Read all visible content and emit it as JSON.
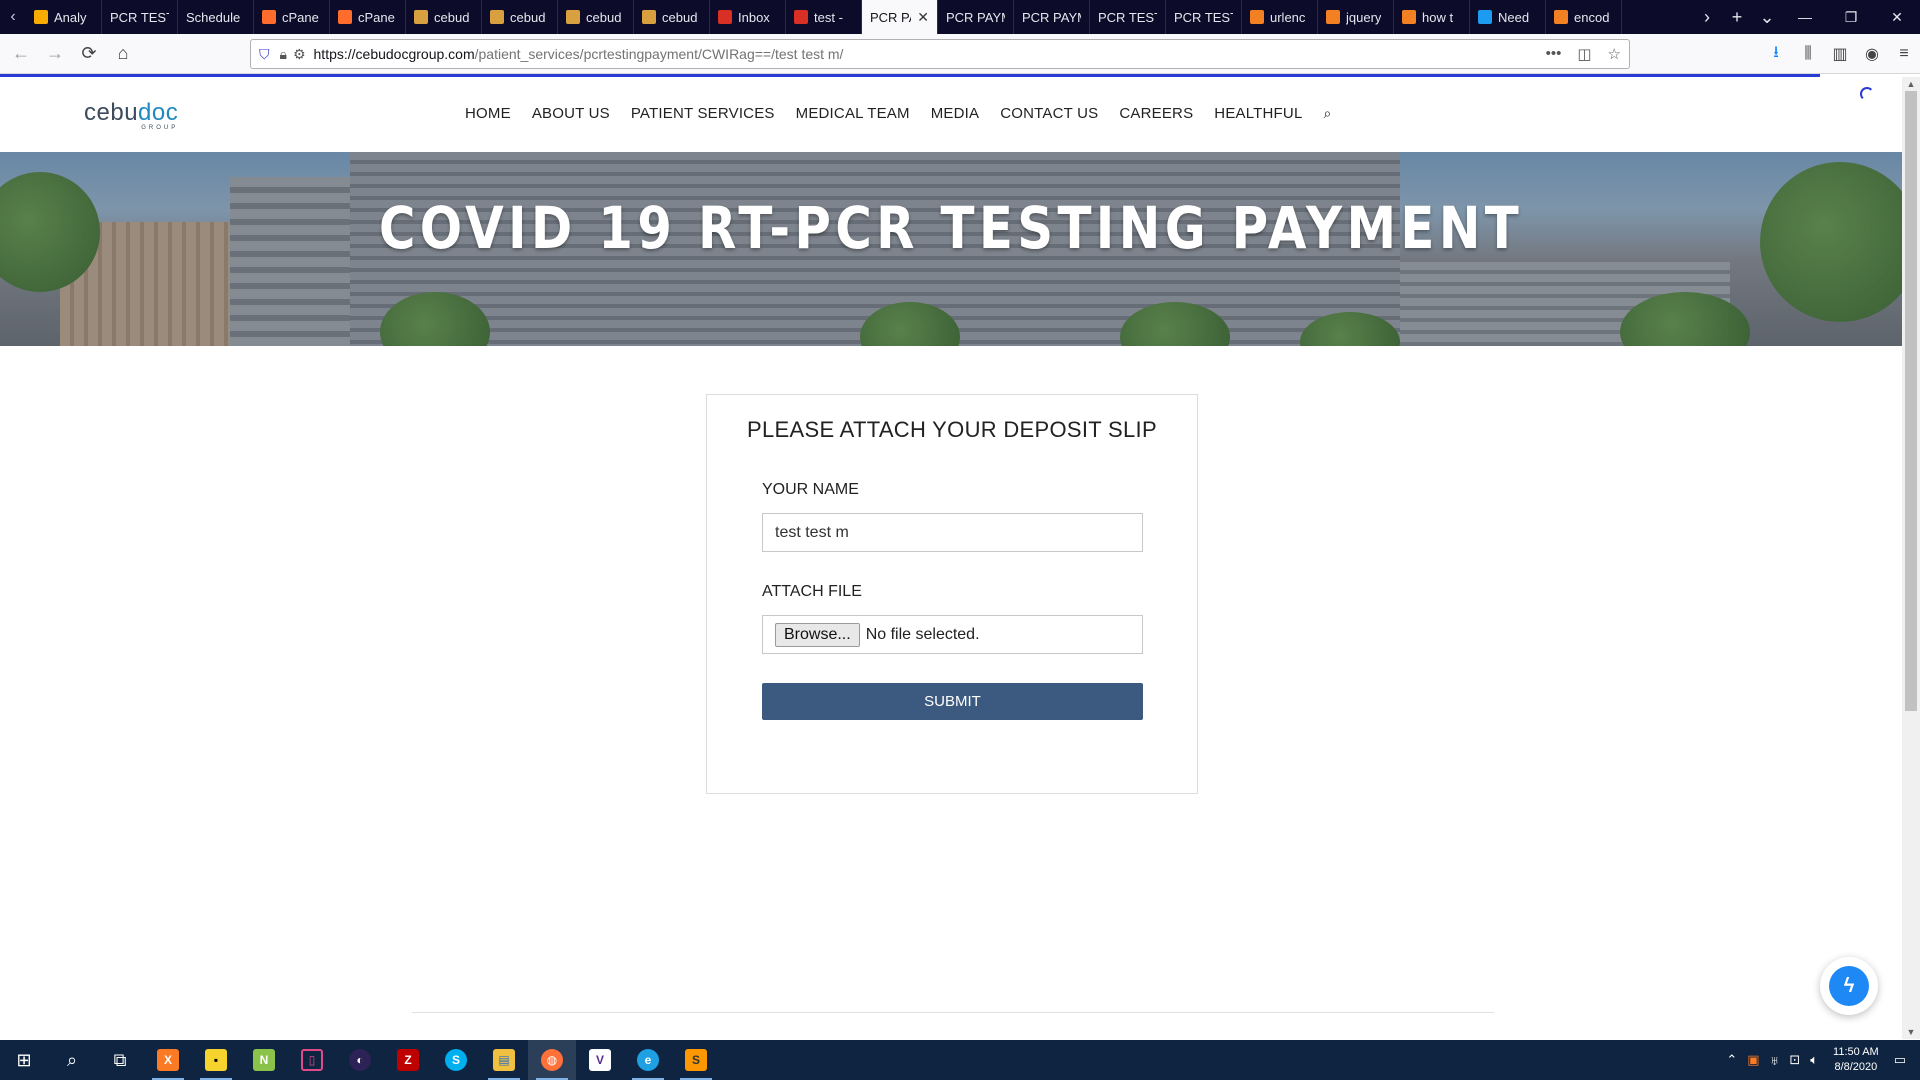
{
  "browser": {
    "tabs": [
      {
        "label": "Analy",
        "icon": "analytics-icon",
        "color": "#f9ab00"
      },
      {
        "label": "PCR TESTI",
        "icon": "",
        "color": ""
      },
      {
        "label": "Schedule",
        "icon": "",
        "color": ""
      },
      {
        "label": "cPane",
        "icon": "cpanel-icon",
        "color": "#ff6c2c"
      },
      {
        "label": "cPane",
        "icon": "cpanel-icon",
        "color": "#ff6c2c"
      },
      {
        "label": "cebud",
        "icon": "cebudoc-icon",
        "color": "#d9a040"
      },
      {
        "label": "cebud",
        "icon": "cebudoc-icon",
        "color": "#d9a040"
      },
      {
        "label": "cebud",
        "icon": "cebudoc-icon",
        "color": "#d9a040"
      },
      {
        "label": "cebud",
        "icon": "cebudoc-icon",
        "color": "#d9a040"
      },
      {
        "label": "Inbox",
        "icon": "gmail-icon",
        "color": "#d93025"
      },
      {
        "label": "test -",
        "icon": "gmail-icon",
        "color": "#d93025"
      },
      {
        "label": "PCR PA",
        "icon": "",
        "color": "",
        "active": true
      },
      {
        "label": "PCR PAYM",
        "icon": "",
        "color": ""
      },
      {
        "label": "PCR PAYM",
        "icon": "",
        "color": ""
      },
      {
        "label": "PCR TESTI",
        "icon": "",
        "color": ""
      },
      {
        "label": "PCR TESTI",
        "icon": "",
        "color": ""
      },
      {
        "label": "urlenc",
        "icon": "stackoverflow-icon",
        "color": "#f48024"
      },
      {
        "label": "jquery",
        "icon": "stackoverflow-icon",
        "color": "#f48024"
      },
      {
        "label": "how t",
        "icon": "stackoverflow-icon",
        "color": "#f48024"
      },
      {
        "label": "Need",
        "icon": "x-icon",
        "color": "#1d9bf0"
      },
      {
        "label": "encod",
        "icon": "stackoverflow-icon",
        "color": "#f48024"
      }
    ],
    "url_host": "https://cebudocgroup.com",
    "url_path": "/patient_services/pcrtestingpayment/CWIRag==/test test m/"
  },
  "site": {
    "logo_text_a": "cebu",
    "logo_text_b": "doc",
    "logo_sub": "GROUP",
    "menu": [
      "HOME",
      "ABOUT US",
      "PATIENT SERVICES",
      "MEDICAL TEAM",
      "MEDIA",
      "CONTACT US",
      "CAREERS",
      "HEALTHFUL"
    ]
  },
  "hero": {
    "title": "COVID 19 RT-PCR TESTING PAYMENT"
  },
  "form": {
    "heading": "PLEASE ATTACH YOUR DEPOSIT SLIP",
    "name_label": "YOUR NAME",
    "name_value": "test test m",
    "file_label": "ATTACH FILE",
    "browse_label": "Browse...",
    "file_status": "No file selected.",
    "submit_label": "SUBMIT"
  },
  "taskbar": {
    "time": "11:50 AM",
    "date": "8/8/2020"
  },
  "colors": {
    "submit_bg": "#3c5a80",
    "tabstrip_bg": "#0c0c2a",
    "taskbar_bg": "#0f2440",
    "logo_accent": "#1f8ac0"
  }
}
